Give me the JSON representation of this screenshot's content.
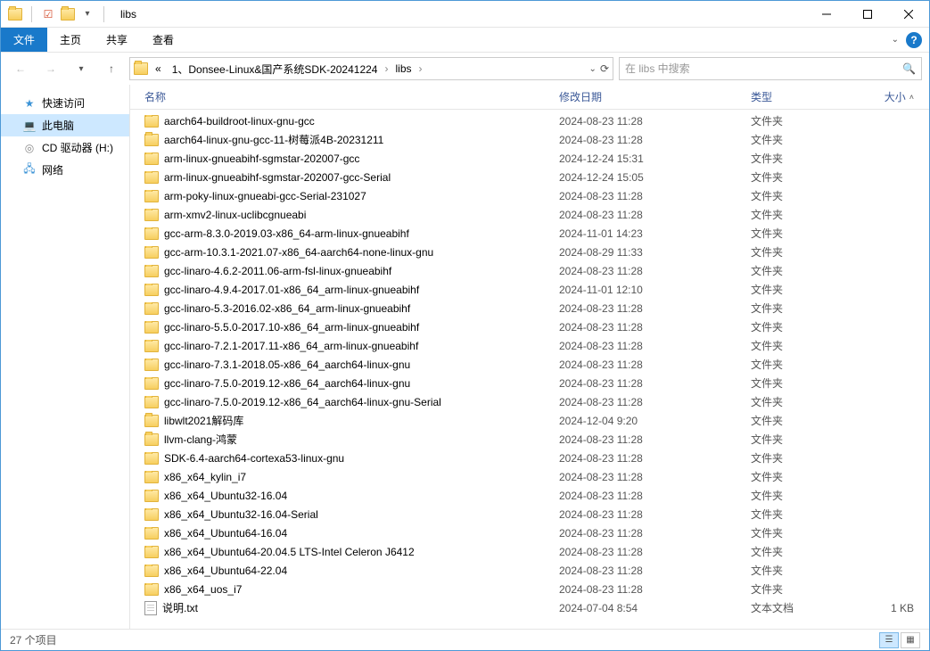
{
  "window": {
    "title": "libs"
  },
  "ribbon": {
    "file": "文件",
    "tabs": [
      "主页",
      "共享",
      "查看"
    ]
  },
  "breadcrumbs": {
    "prefix": "«",
    "items": [
      "1、Donsee-Linux&国产系统SDK-20241224",
      "libs"
    ]
  },
  "search": {
    "placeholder": "在 libs 中搜索"
  },
  "nav_pane": {
    "quick_access": "快速访问",
    "this_pc": "此电脑",
    "cd_drive": "CD 驱动器 (H:)",
    "network": "网络"
  },
  "columns": {
    "name": "名称",
    "date": "修改日期",
    "type": "类型",
    "size": "大小"
  },
  "type_labels": {
    "folder": "文件夹",
    "text": "文本文档"
  },
  "files": [
    {
      "name": "aarch64-buildroot-linux-gnu-gcc",
      "date": "2024-08-23 11:28",
      "kind": "folder",
      "size": ""
    },
    {
      "name": "aarch64-linux-gnu-gcc-11-树莓派4B-20231211",
      "date": "2024-08-23 11:28",
      "kind": "folder",
      "size": ""
    },
    {
      "name": "arm-linux-gnueabihf-sgmstar-202007-gcc",
      "date": "2024-12-24 15:31",
      "kind": "folder",
      "size": ""
    },
    {
      "name": "arm-linux-gnueabihf-sgmstar-202007-gcc-Serial",
      "date": "2024-12-24 15:05",
      "kind": "folder",
      "size": ""
    },
    {
      "name": "arm-poky-linux-gnueabi-gcc-Serial-231027",
      "date": "2024-08-23 11:28",
      "kind": "folder",
      "size": ""
    },
    {
      "name": "arm-xmv2-linux-uclibcgnueabi",
      "date": "2024-08-23 11:28",
      "kind": "folder",
      "size": ""
    },
    {
      "name": "gcc-arm-8.3.0-2019.03-x86_64-arm-linux-gnueabihf",
      "date": "2024-11-01 14:23",
      "kind": "folder",
      "size": ""
    },
    {
      "name": "gcc-arm-10.3.1-2021.07-x86_64-aarch64-none-linux-gnu",
      "date": "2024-08-29 11:33",
      "kind": "folder",
      "size": ""
    },
    {
      "name": "gcc-linaro-4.6.2-2011.06-arm-fsl-linux-gnueabihf",
      "date": "2024-08-23 11:28",
      "kind": "folder",
      "size": ""
    },
    {
      "name": "gcc-linaro-4.9.4-2017.01-x86_64_arm-linux-gnueabihf",
      "date": "2024-11-01 12:10",
      "kind": "folder",
      "size": ""
    },
    {
      "name": "gcc-linaro-5.3-2016.02-x86_64_arm-linux-gnueabihf",
      "date": "2024-08-23 11:28",
      "kind": "folder",
      "size": ""
    },
    {
      "name": "gcc-linaro-5.5.0-2017.10-x86_64_arm-linux-gnueabihf",
      "date": "2024-08-23 11:28",
      "kind": "folder",
      "size": ""
    },
    {
      "name": "gcc-linaro-7.2.1-2017.11-x86_64_arm-linux-gnueabihf",
      "date": "2024-08-23 11:28",
      "kind": "folder",
      "size": ""
    },
    {
      "name": "gcc-linaro-7.3.1-2018.05-x86_64_aarch64-linux-gnu",
      "date": "2024-08-23 11:28",
      "kind": "folder",
      "size": ""
    },
    {
      "name": "gcc-linaro-7.5.0-2019.12-x86_64_aarch64-linux-gnu",
      "date": "2024-08-23 11:28",
      "kind": "folder",
      "size": ""
    },
    {
      "name": "gcc-linaro-7.5.0-2019.12-x86_64_aarch64-linux-gnu-Serial",
      "date": "2024-08-23 11:28",
      "kind": "folder",
      "size": ""
    },
    {
      "name": "libwlt2021解码库",
      "date": "2024-12-04 9:20",
      "kind": "folder",
      "size": ""
    },
    {
      "name": "llvm-clang-鸿蒙",
      "date": "2024-08-23 11:28",
      "kind": "folder",
      "size": ""
    },
    {
      "name": "SDK-6.4-aarch64-cortexa53-linux-gnu",
      "date": "2024-08-23 11:28",
      "kind": "folder",
      "size": ""
    },
    {
      "name": "x86_x64_kylin_i7",
      "date": "2024-08-23 11:28",
      "kind": "folder",
      "size": ""
    },
    {
      "name": "x86_x64_Ubuntu32-16.04",
      "date": "2024-08-23 11:28",
      "kind": "folder",
      "size": ""
    },
    {
      "name": "x86_x64_Ubuntu32-16.04-Serial",
      "date": "2024-08-23 11:28",
      "kind": "folder",
      "size": ""
    },
    {
      "name": "x86_x64_Ubuntu64-16.04",
      "date": "2024-08-23 11:28",
      "kind": "folder",
      "size": ""
    },
    {
      "name": "x86_x64_Ubuntu64-20.04.5 LTS-Intel Celeron J6412",
      "date": "2024-08-23 11:28",
      "kind": "folder",
      "size": ""
    },
    {
      "name": "x86_x64_Ubuntu64-22.04",
      "date": "2024-08-23 11:28",
      "kind": "folder",
      "size": ""
    },
    {
      "name": "x86_x64_uos_i7",
      "date": "2024-08-23 11:28",
      "kind": "folder",
      "size": ""
    },
    {
      "name": "说明.txt",
      "date": "2024-07-04 8:54",
      "kind": "text",
      "size": "1 KB"
    }
  ],
  "status": {
    "item_count": "27 个项目"
  }
}
